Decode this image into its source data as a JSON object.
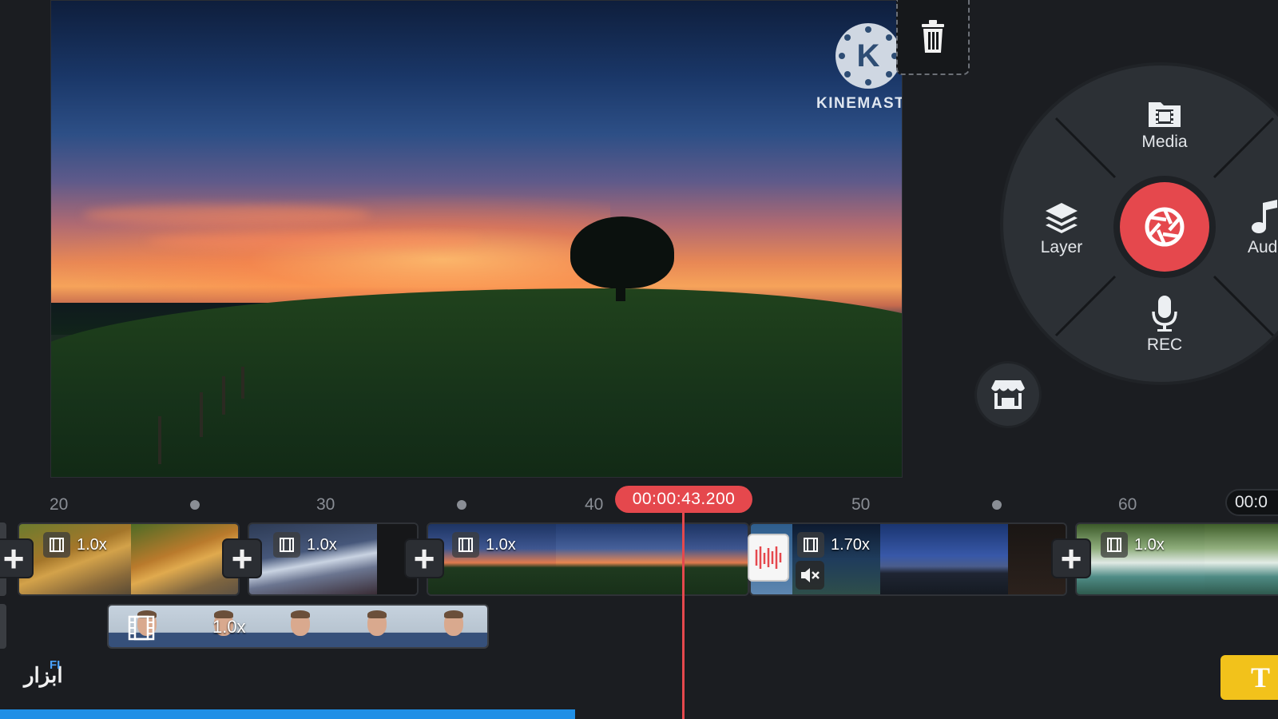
{
  "app": {
    "name": "KineMaster"
  },
  "preview": {
    "logo_letter": "K",
    "logo_text": "KINEMASTER"
  },
  "toolbar": {
    "delete_icon": "trash-icon"
  },
  "media_wheel": {
    "items": {
      "media": {
        "label": "Media",
        "icon": "media-icon"
      },
      "layer": {
        "label": "Layer",
        "icon": "layers-icon"
      },
      "audio": {
        "label": "Audi",
        "icon": "music-note-icon"
      },
      "rec": {
        "label": "REC",
        "icon": "microphone-icon"
      }
    },
    "record_icon": "camera-shutter-icon",
    "record_color": "#e5484d"
  },
  "store_icon": "store-icon",
  "timeline": {
    "ruler_labels": [
      "20",
      "30",
      "40",
      "50",
      "60"
    ],
    "current_time": "00:00:43.200",
    "end_time": "00:0",
    "clips": [
      {
        "speed": "1.0x"
      },
      {
        "speed": "1.0x"
      },
      {
        "speed": "1.0x"
      },
      {
        "speed": "1.70x",
        "muted": true
      },
      {
        "speed": "1.0x"
      }
    ],
    "layer_clip": {
      "speed": "1.0x"
    },
    "add_icon": "plus-icon"
  },
  "watermark": {
    "text": "ابزار",
    "badge": "FI"
  },
  "text_button": {
    "label": "T"
  },
  "progress": 0.45
}
